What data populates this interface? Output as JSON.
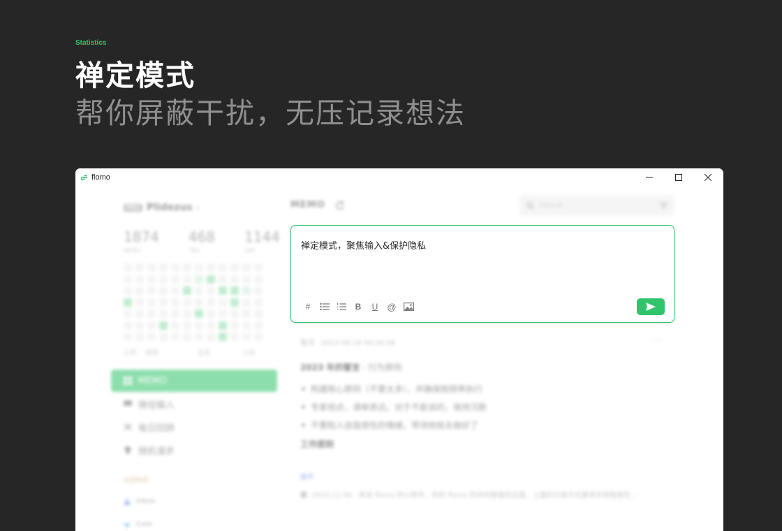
{
  "hero": {
    "tag": "Statistics",
    "title": "禅定模式",
    "subtitle": "帮你屏蔽干扰，无压记录想法"
  },
  "window": {
    "app_name": "flomo",
    "controls": [
      "minimize-icon",
      "maximize-icon",
      "close-icon"
    ]
  },
  "sidebar": {
    "pro_badge": "PRO",
    "username": "Plidezus",
    "stats": [
      {
        "value": "1874",
        "label": "MEMO"
      },
      {
        "value": "468",
        "label": "TAG"
      },
      {
        "value": "1144",
        "label": "DAY"
      }
    ],
    "heatmap_months": [
      "三月",
      "四月",
      "五月",
      "六月"
    ],
    "heatmap_levels": [
      [
        0,
        0,
        0,
        0,
        0,
        0,
        0,
        0,
        0,
        0,
        0,
        0
      ],
      [
        0,
        0,
        0,
        0,
        0,
        0,
        1,
        2,
        0,
        0,
        0,
        0
      ],
      [
        0,
        0,
        0,
        0,
        0,
        2,
        0,
        0,
        2,
        2,
        1,
        0
      ],
      [
        2,
        0,
        0,
        0,
        0,
        0,
        0,
        0,
        0,
        2,
        0,
        0
      ],
      [
        0,
        0,
        0,
        0,
        0,
        0,
        2,
        0,
        0,
        0,
        0,
        0
      ],
      [
        0,
        0,
        0,
        2,
        0,
        0,
        0,
        0,
        2,
        0,
        0,
        0
      ],
      [
        0,
        0,
        0,
        0,
        0,
        0,
        0,
        0,
        2,
        0,
        0,
        0
      ]
    ],
    "nav": [
      {
        "label": "MEMO",
        "icon": "grid-icon",
        "active": true
      },
      {
        "label": "微信输入",
        "icon": "chat-icon",
        "active": false
      },
      {
        "label": "每日回顾",
        "icon": "shuffle-icon",
        "active": false
      },
      {
        "label": "随机漫步",
        "icon": "bulb-icon",
        "active": false
      }
    ],
    "section_label": "全部标签",
    "tags": [
      {
        "label": "inbox",
        "icon": "tag-icon",
        "color": "#6b8cf0"
      },
      {
        "label": "Core",
        "icon": "tag-icon",
        "color": "#5ab0e8"
      }
    ]
  },
  "main": {
    "header_title": "MEMO",
    "search_placeholder": "Ctrl+K",
    "editor": {
      "text": "禅定模式，聚焦输入&保护隐私",
      "toolbar": [
        {
          "name": "hashtag",
          "glyph": "#"
        },
        {
          "name": "bullet-list",
          "glyph": ""
        },
        {
          "name": "numbered-list",
          "glyph": ""
        },
        {
          "name": "bold",
          "glyph": "B"
        },
        {
          "name": "underline",
          "glyph": "U"
        },
        {
          "name": "mention",
          "glyph": "@"
        },
        {
          "name": "image",
          "glyph": ""
        }
      ]
    },
    "memo": {
      "meta": "置顶 · 2023-06-18 09:26:48",
      "heading": "2023 年的誓言",
      "heading_suffix": " - 行为原则",
      "bullets": [
        "构建核心原则（不要太多），并确保按频率执行",
        "专家视点，清晰表达。对于不能说的，保持沉默",
        "不要陷入自我感性的情绪，带领他就去做好了"
      ],
      "subheading": "工作原则",
      "expand_link": "展开",
      "footer": "2023-11-06 · 来自 flomo 的小助手，你的 flomo 同步的数据在这里。上面的分类方式要求你将我放在..."
    }
  },
  "colors": {
    "accent": "#31c46b",
    "hero_bg": "#262626",
    "hero_subtitle": "#8f8f8f"
  }
}
